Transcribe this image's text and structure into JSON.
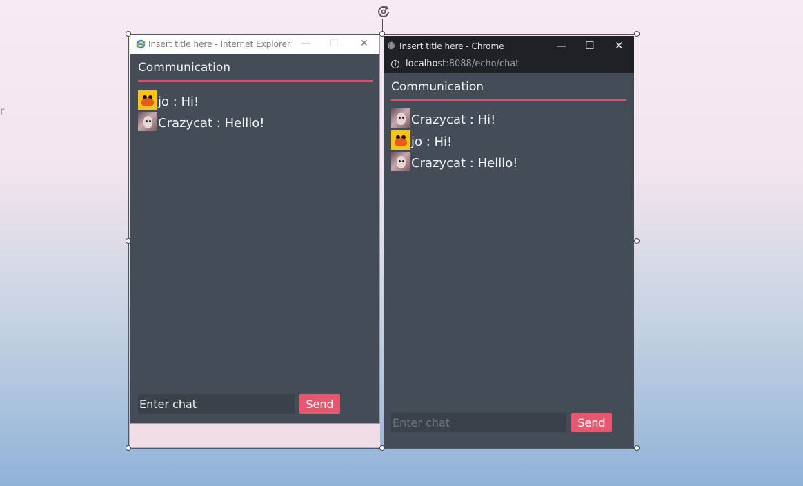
{
  "stray_char": "r",
  "ie": {
    "title": "Insert title here - Internet Explorer",
    "minimize": "—",
    "maximize": "☐",
    "close": "✕",
    "app_title": "Communication",
    "messages": [
      {
        "avatar": "duck-avatar",
        "text": "jo : Hi!"
      },
      {
        "avatar": "cat-avatar",
        "text": "Crazycat : Helllo!"
      }
    ],
    "input_placeholder": "Enter chat",
    "send_label": "Send"
  },
  "chrome": {
    "title": "Insert title here - Chrome",
    "minimize": "—",
    "maximize": "☐",
    "close": "✕",
    "url_host": "localhost",
    "url_path": ":8088/echo/chat",
    "app_title": "Communication",
    "messages": [
      {
        "avatar": "cat-avatar",
        "text": "Crazycat : Hi!"
      },
      {
        "avatar": "duck-avatar",
        "text": "jo : Hi!"
      },
      {
        "avatar": "cat-avatar",
        "text": "Crazycat : Helllo!"
      }
    ],
    "input_placeholder": "Enter chat",
    "send_label": "Send"
  },
  "colors": {
    "accent": "#e85770",
    "panel": "#434c57",
    "chrome_bar": "#202124"
  }
}
